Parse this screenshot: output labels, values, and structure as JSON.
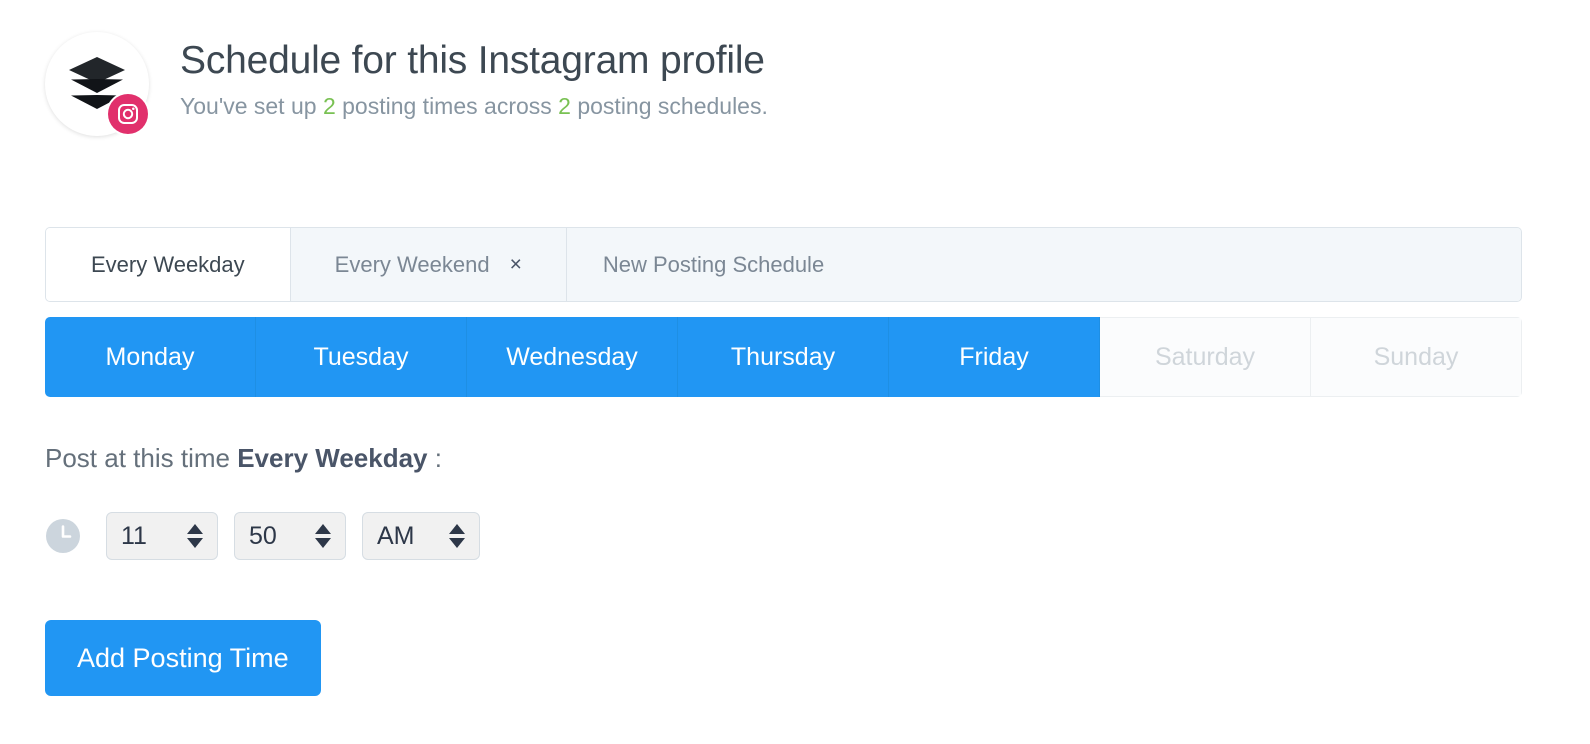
{
  "header": {
    "title": "Schedule for this Instagram profile",
    "subtitle_prefix": "You've set up ",
    "times_count": "2",
    "subtitle_middle": " posting times across ",
    "schedules_count": "2",
    "subtitle_suffix": " posting schedules.",
    "avatar_icon": "buffer-stack-icon",
    "network_badge_icon": "instagram-icon",
    "accent_green": "#79c153"
  },
  "tabs": [
    {
      "label": "Every Weekday",
      "active": true,
      "closable": false
    },
    {
      "label": "Every Weekend",
      "active": false,
      "closable": true,
      "close_glyph": "×"
    },
    {
      "label": "New Posting Schedule",
      "active": false,
      "closable": false
    }
  ],
  "days": [
    {
      "label": "Monday",
      "selected": true
    },
    {
      "label": "Tuesday",
      "selected": true
    },
    {
      "label": "Wednesday",
      "selected": true
    },
    {
      "label": "Thursday",
      "selected": true
    },
    {
      "label": "Friday",
      "selected": true
    },
    {
      "label": "Saturday",
      "selected": false
    },
    {
      "label": "Sunday",
      "selected": false
    }
  ],
  "post_label": {
    "prefix": "Post at this time ",
    "schedule_name": "Every Weekday",
    "suffix": " :"
  },
  "time": {
    "clock_icon": "clock-icon",
    "hour": "11",
    "minute": "50",
    "meridiem": "AM"
  },
  "actions": {
    "add_posting_time": "Add Posting Time"
  },
  "colors": {
    "primary_blue": "#2196f3",
    "instagram_pink": "#e1306c",
    "accent_green": "#79c153",
    "text_dark": "#3d4852",
    "text_muted": "#8795a1"
  }
}
